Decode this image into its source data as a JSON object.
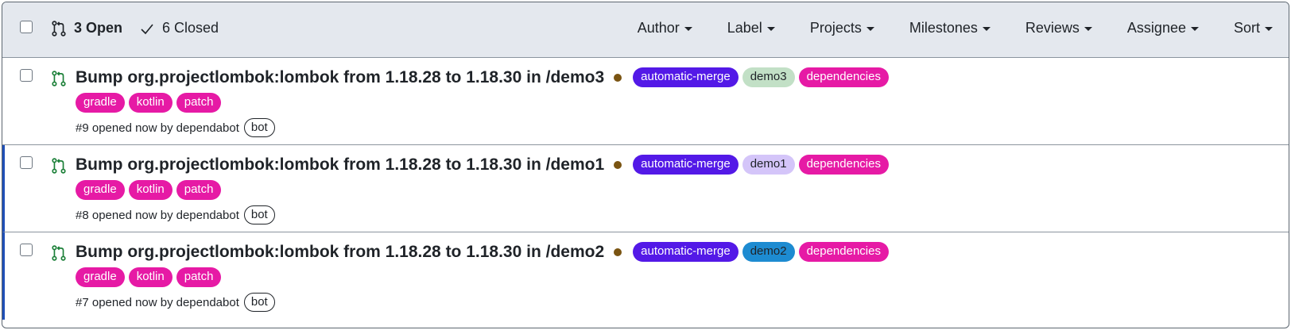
{
  "header": {
    "open_label": "3 Open",
    "closed_label": "6 Closed",
    "filters": [
      "Author",
      "Label",
      "Projects",
      "Milestones",
      "Reviews",
      "Assignee",
      "Sort"
    ]
  },
  "pulls": [
    {
      "title": "Bump org.projectlombok:lombok from 1.18.28 to 1.18.30 in /demo3",
      "labels_line1": [
        {
          "name": "automatic-merge",
          "bg": "#5319e7",
          "fg": "#ffffff"
        },
        {
          "name": "demo3",
          "bg": "#c2e0c6",
          "fg": "#1f2328"
        },
        {
          "name": "dependencies",
          "bg": "#e61aa5",
          "fg": "#ffffff"
        }
      ],
      "labels_line2": [
        {
          "name": "gradle",
          "bg": "#e61aa5",
          "fg": "#ffffff"
        },
        {
          "name": "kotlin",
          "bg": "#e61aa5",
          "fg": "#ffffff"
        },
        {
          "name": "patch",
          "bg": "#e61aa5",
          "fg": "#ffffff"
        }
      ],
      "meta_prefix": "#9 opened now by",
      "author": "dependabot",
      "badge": "bot"
    },
    {
      "title": "Bump org.projectlombok:lombok from 1.18.28 to 1.18.30 in /demo1",
      "labels_line1": [
        {
          "name": "automatic-merge",
          "bg": "#5319e7",
          "fg": "#ffffff"
        },
        {
          "name": "demo1",
          "bg": "#d4c5f9",
          "fg": "#1f2328"
        },
        {
          "name": "dependencies",
          "bg": "#e61aa5",
          "fg": "#ffffff"
        }
      ],
      "labels_line2": [
        {
          "name": "gradle",
          "bg": "#e61aa5",
          "fg": "#ffffff"
        },
        {
          "name": "kotlin",
          "bg": "#e61aa5",
          "fg": "#ffffff"
        },
        {
          "name": "patch",
          "bg": "#e61aa5",
          "fg": "#ffffff"
        }
      ],
      "meta_prefix": "#8 opened now by",
      "author": "dependabot",
      "badge": "bot"
    },
    {
      "title": "Bump org.projectlombok:lombok from 1.18.28 to 1.18.30 in /demo2",
      "labels_line1": [
        {
          "name": "automatic-merge",
          "bg": "#5319e7",
          "fg": "#ffffff"
        },
        {
          "name": "demo2",
          "bg": "#1d8bd1",
          "fg": "#1f2328"
        },
        {
          "name": "dependencies",
          "bg": "#e61aa5",
          "fg": "#ffffff"
        }
      ],
      "labels_line2": [
        {
          "name": "gradle",
          "bg": "#e61aa5",
          "fg": "#ffffff"
        },
        {
          "name": "kotlin",
          "bg": "#e61aa5",
          "fg": "#ffffff"
        },
        {
          "name": "patch",
          "bg": "#e61aa5",
          "fg": "#ffffff"
        }
      ],
      "meta_prefix": "#7 opened now by",
      "author": "dependabot",
      "badge": "bot"
    }
  ],
  "colors": {
    "open_icon": "#1a7f37",
    "status_dot": "#7a5412",
    "selected_bar": "#1f4fb8"
  }
}
